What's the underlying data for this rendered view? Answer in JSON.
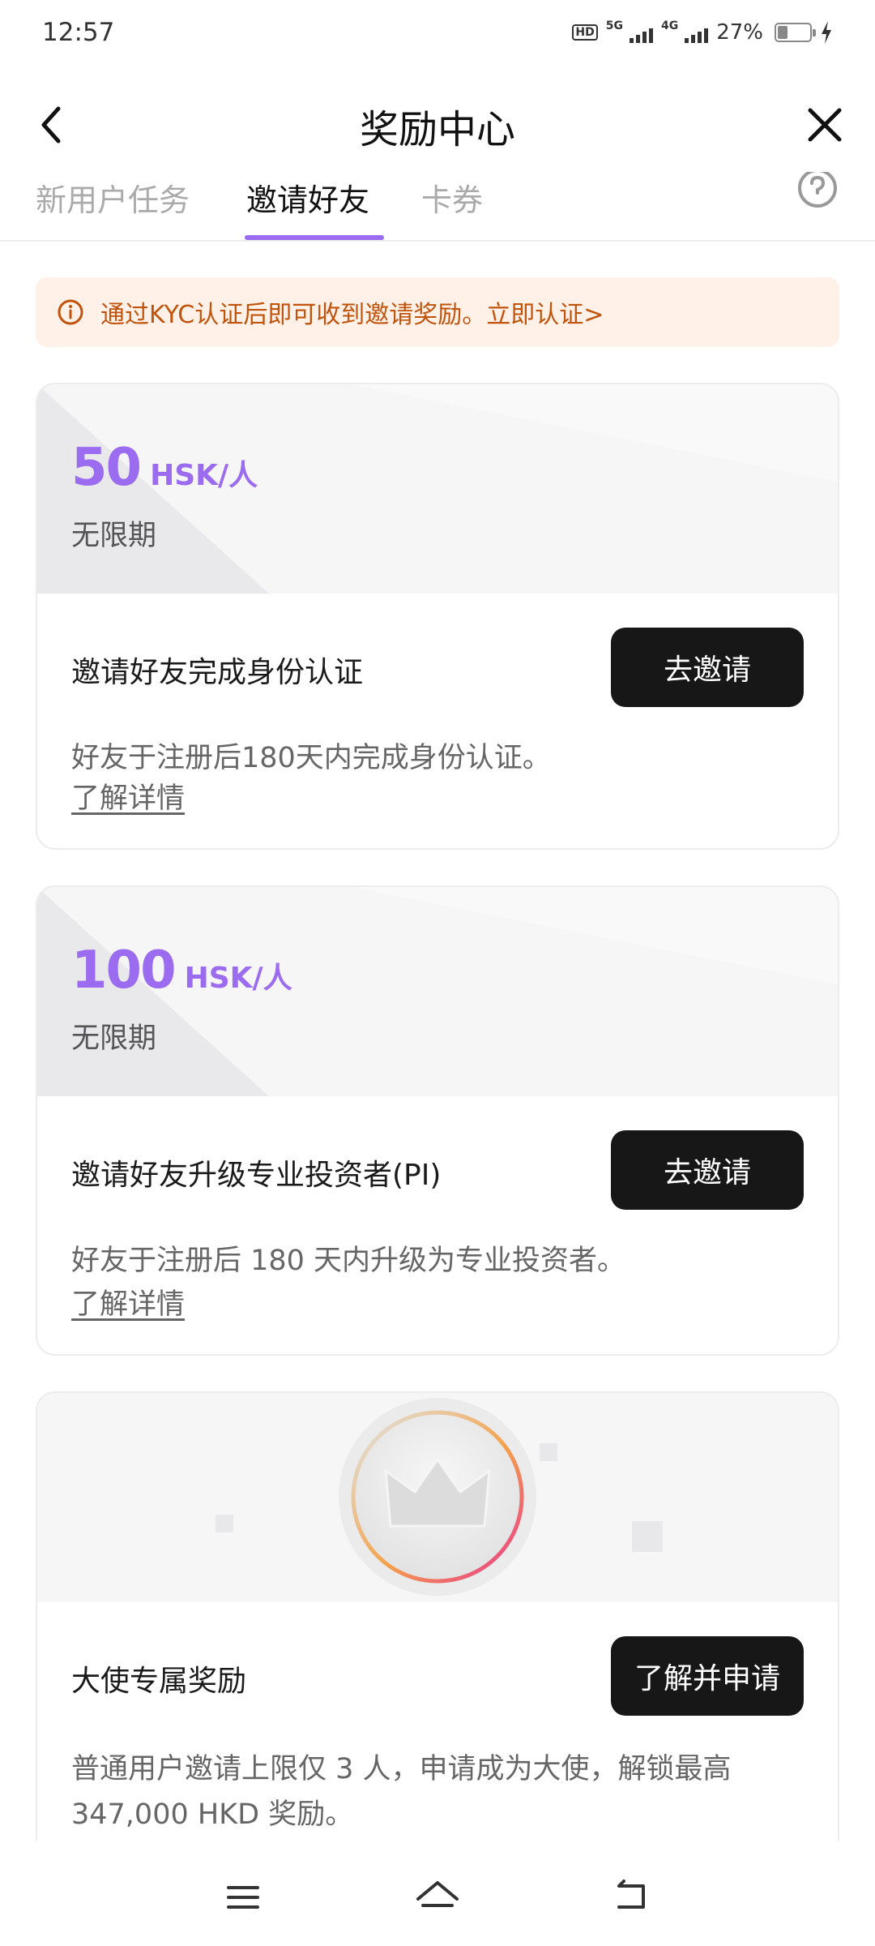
{
  "status_bar": {
    "time": "12:57",
    "hd_label": "HD",
    "network_1": "5G",
    "network_2": "4G",
    "battery": "27%"
  },
  "header": {
    "title": "奖励中心"
  },
  "tabs": [
    {
      "label": "新用户任务"
    },
    {
      "label": "邀请好友",
      "active": true
    },
    {
      "label": "卡券"
    }
  ],
  "notice": {
    "text": "通过KYC认证后即可收到邀请奖励。立即认证>"
  },
  "cards": [
    {
      "amount": "50",
      "unit": "HSK/人",
      "period": "无限期",
      "title": "邀请好友完成身份认证",
      "button": "去邀请",
      "desc": "好友于注册后180天内完成身份认证。",
      "more": "了解详情"
    },
    {
      "amount": "100",
      "unit": "HSK/人",
      "period": "无限期",
      "title": "邀请好友升级专业投资者(PI)",
      "button": "去邀请",
      "desc": "好友于注册后 180 天内升级为专业投资者。",
      "more": "了解详情"
    },
    {
      "title": "大使专属奖励",
      "button": "了解并申请",
      "desc": "普通用户邀请上限仅 3 人，申请成为大使，解锁最高 347,000 HKD 奖励。"
    }
  ],
  "colors": {
    "accent": "#9b6cf0",
    "button_bg": "#171717",
    "notice_bg": "#fff1e8",
    "notice_text": "#c0540c"
  },
  "icons": {
    "back": "chevron-left-icon",
    "close": "close-icon",
    "help": "question-circle-icon",
    "info": "info-circle-icon",
    "crown": "crown-icon",
    "nav_menu": "menu-icon",
    "nav_home": "home-icon",
    "nav_back": "return-icon"
  }
}
